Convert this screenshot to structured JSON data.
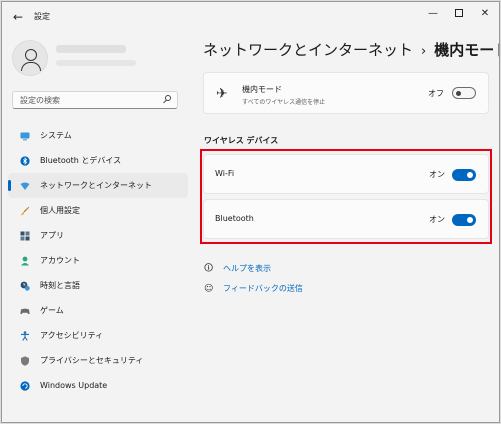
{
  "window": {
    "title": "設定",
    "back_glyph": "←",
    "minimize_glyph": "—",
    "close_glyph": "✕"
  },
  "search": {
    "placeholder": "設定の検索"
  },
  "nav": {
    "items": [
      {
        "label": "システム",
        "icon": "monitor-icon"
      },
      {
        "label": "Bluetooth とデバイス",
        "icon": "bluetooth-icon"
      },
      {
        "label": "ネットワークとインターネット",
        "icon": "network-icon",
        "active": true
      },
      {
        "label": "個人用設定",
        "icon": "brush-icon"
      },
      {
        "label": "アプリ",
        "icon": "apps-icon"
      },
      {
        "label": "アカウント",
        "icon": "account-icon"
      },
      {
        "label": "時刻と言語",
        "icon": "clock-icon"
      },
      {
        "label": "ゲーム",
        "icon": "game-icon"
      },
      {
        "label": "アクセシビリティ",
        "icon": "accessibility-icon"
      },
      {
        "label": "プライバシーとセキュリティ",
        "icon": "shield-icon"
      },
      {
        "label": "Windows Update",
        "icon": "update-icon"
      }
    ]
  },
  "breadcrumb": {
    "parent": "ネットワークとインターネット",
    "separator": "›",
    "current": "機内モード"
  },
  "airplane": {
    "title": "機内モード",
    "subtitle": "すべてのワイヤレス通信を停止",
    "state_label": "オフ",
    "on": false
  },
  "wireless_section": {
    "title": "ワイヤレス デバイス",
    "rows": [
      {
        "label": "Wi-Fi",
        "state_label": "オン",
        "on": true
      },
      {
        "label": "Bluetooth",
        "state_label": "オン",
        "on": true
      }
    ]
  },
  "links": {
    "help": "ヘルプを表示",
    "feedback": "フィードバックの送信"
  },
  "colors": {
    "accent": "#0067c0",
    "highlight_box": "#e60012"
  }
}
